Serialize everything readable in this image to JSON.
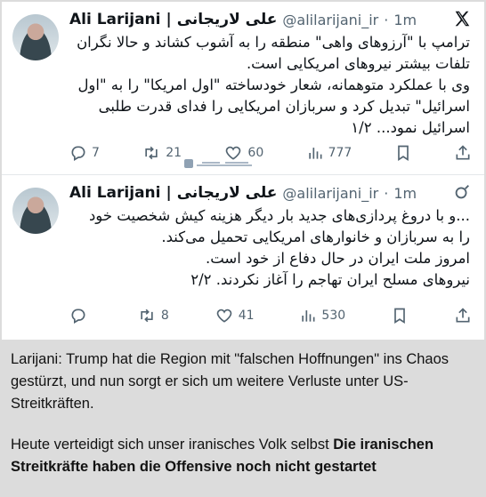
{
  "tweets": [
    {
      "name_en": "Ali Larijani",
      "separator": "|",
      "name_fa": "علی لاریجانی",
      "handle": "@alilarijani_ir",
      "dot": "·",
      "time": "1m",
      "corner_icon": "x-logo-icon",
      "lines": [
        "ترامپ با \"آرزوهای واهی\" منطقه را به آشوب کشاند و حالا نگران",
        "تلفات بیشتر نیروهای امریکایی است.",
        "وی با عملکرد متوهمانه، شعار خودساخته \"اول امریکا\" را به \"اول",
        "اسرائیل\" تبدیل کرد و سربازان امریکایی را فدای قدرت طلبی",
        "اسرائیل نمود... ۱/۲"
      ],
      "actions": {
        "replies": "7",
        "reposts": "21",
        "likes": "60",
        "views": "777"
      }
    },
    {
      "name_en": "Ali Larijani",
      "separator": "|",
      "name_fa": "علی لاریجانی",
      "handle": "@alilarijani_ir",
      "dot": "·",
      "time": "1m",
      "corner_icon": "link-icon",
      "lines": [
        "...و با دروغ پردازی‌های جدید بار دیگر هزینه کیش شخصیت خود",
        "را به سربازان و خانوارهای امریکایی تحمیل می‌کند.",
        "امروز ملت ایران در حال دفاع از خود است.",
        "نیروهای مسلح ایران تهاجم را آغاز نکردند. ۲/۲"
      ],
      "actions": {
        "replies": "",
        "reposts": "8",
        "likes": "41",
        "views": "530"
      }
    }
  ],
  "caption": {
    "p1": "Larijani: Trump hat die Region mit \"falschen Hoffnungen\" ins Chaos gestürzt, und nun sorgt er sich um weitere Verluste unter US-Streitkräften.",
    "p2_plain": "Heute verteidigt sich unser iranisches Volk selbst ",
    "p2_bold": "Die iranischen Streitkräfte haben die Offensive noch nicht gestartet"
  },
  "colors": {
    "text": "#0f1419",
    "secondary": "#536471",
    "background": "#ffffff",
    "page": "#dcdcdc"
  }
}
